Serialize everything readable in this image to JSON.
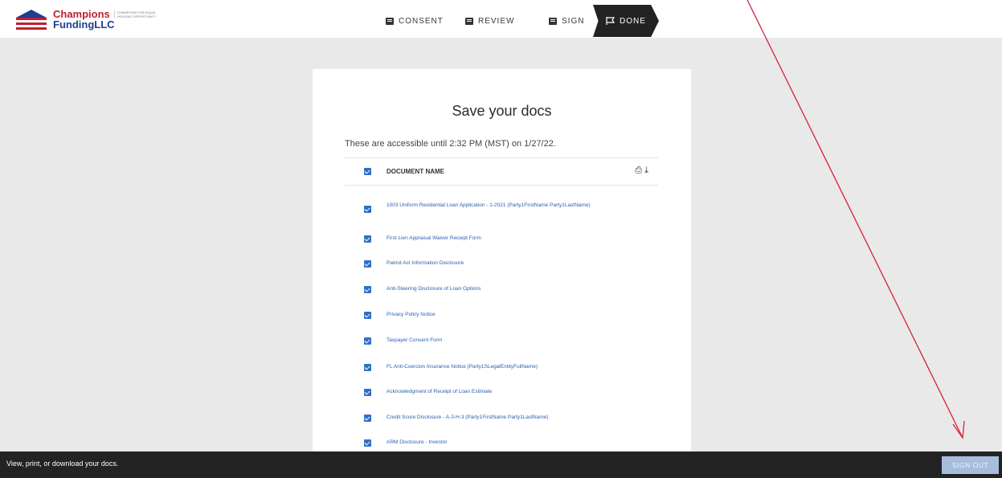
{
  "logo": {
    "brand_top": "Champions",
    "brand_bottom": "FundingLLC",
    "tagline": "CHAMPIONS FOR EQUAL HOUSING OPPORTUNITY"
  },
  "steps": [
    {
      "label": "CONSENT"
    },
    {
      "label": "REVIEW"
    },
    {
      "label": "SIGN"
    },
    {
      "label": "DONE"
    }
  ],
  "card": {
    "title": "Save your docs",
    "subtitle": "These are accessible until 2:32 PM (MST) on 1/27/22.",
    "header": "DOCUMENT NAME"
  },
  "documents": [
    "1003 Uniform Residential Loan Application - 1-2021 (Party1FirstName Party1LastName)",
    "First Lien Appraisal Waiver Receipt Form",
    "Patriot Act Information Disclosure",
    "Anti-Steering Disclosure of Loan Options",
    "Privacy Policy Notice",
    "Taxpayer Consent Form",
    "FL Anti-Coercion Insurance Notice (Party1SLegalEntityFullName)",
    "Acknowledgment of Receipt of Loan Estimate",
    "Credit Score Disclosure - A-3-H-3 (Party1FirstName Party1LastName)",
    "ARM Disclosure - Investor"
  ],
  "footer": {
    "message": "View, print, or download your docs.",
    "signout": "SIGN OUT"
  },
  "colors": {
    "accent": "#2f6ec7",
    "annotation": "#d6203a"
  }
}
